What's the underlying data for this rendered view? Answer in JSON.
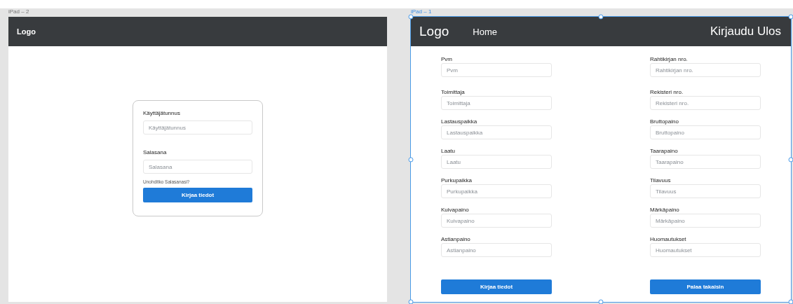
{
  "frames": [
    {
      "title": "iPad – 2",
      "selected": false,
      "kind": "login",
      "header": {
        "logo": "Logo"
      },
      "fields": [
        {
          "label": "Käyttäjätunnus",
          "placeholder": "Käyttäjätunnus"
        },
        {
          "label": "Salasana",
          "placeholder": "Salasana"
        }
      ],
      "link": "Unohditko Salasanasi?",
      "buttons": [
        "Kirjaa tiedot"
      ]
    },
    {
      "title": "iPad – 1",
      "selected": true,
      "kind": "form",
      "header": {
        "logo": "Logo",
        "nav": "Home",
        "action": "Kirjaudu Ulos"
      },
      "columns": [
        [
          {
            "label": "Pvm",
            "placeholder": "Pvm"
          },
          {
            "label": "Toimittaja",
            "placeholder": "Toimittaja"
          },
          {
            "label": "Lastauspaikka",
            "placeholder": "Lastauspaikka"
          },
          {
            "label": "Laatu",
            "placeholder": "Laatu"
          },
          {
            "label": "Purkupaikka",
            "placeholder": "Purkupaikka"
          },
          {
            "label": "Kuivapaino",
            "placeholder": "Kuivapaino"
          },
          {
            "label": "Astianpaino",
            "placeholder": "Astianpaino"
          }
        ],
        [
          {
            "label": "Rahtikirjan nro.",
            "placeholder": "Rahtikirjan nro."
          },
          {
            "label": "Rekisteri nro.",
            "placeholder": "Rekisteri nro."
          },
          {
            "label": "Bruttopaino",
            "placeholder": "Bruttopaino"
          },
          {
            "label": "Taarapaino",
            "placeholder": "Taarapaino"
          },
          {
            "label": "Tilavuus",
            "placeholder": "Tilavuus"
          },
          {
            "label": "Märkäpaino",
            "placeholder": "Märkäpaino"
          },
          {
            "label": "Huomautukset",
            "placeholder": "Huomautukset"
          }
        ]
      ],
      "buttons": [
        "Kirjaa tiedot",
        "Palaa takaisin"
      ]
    }
  ]
}
